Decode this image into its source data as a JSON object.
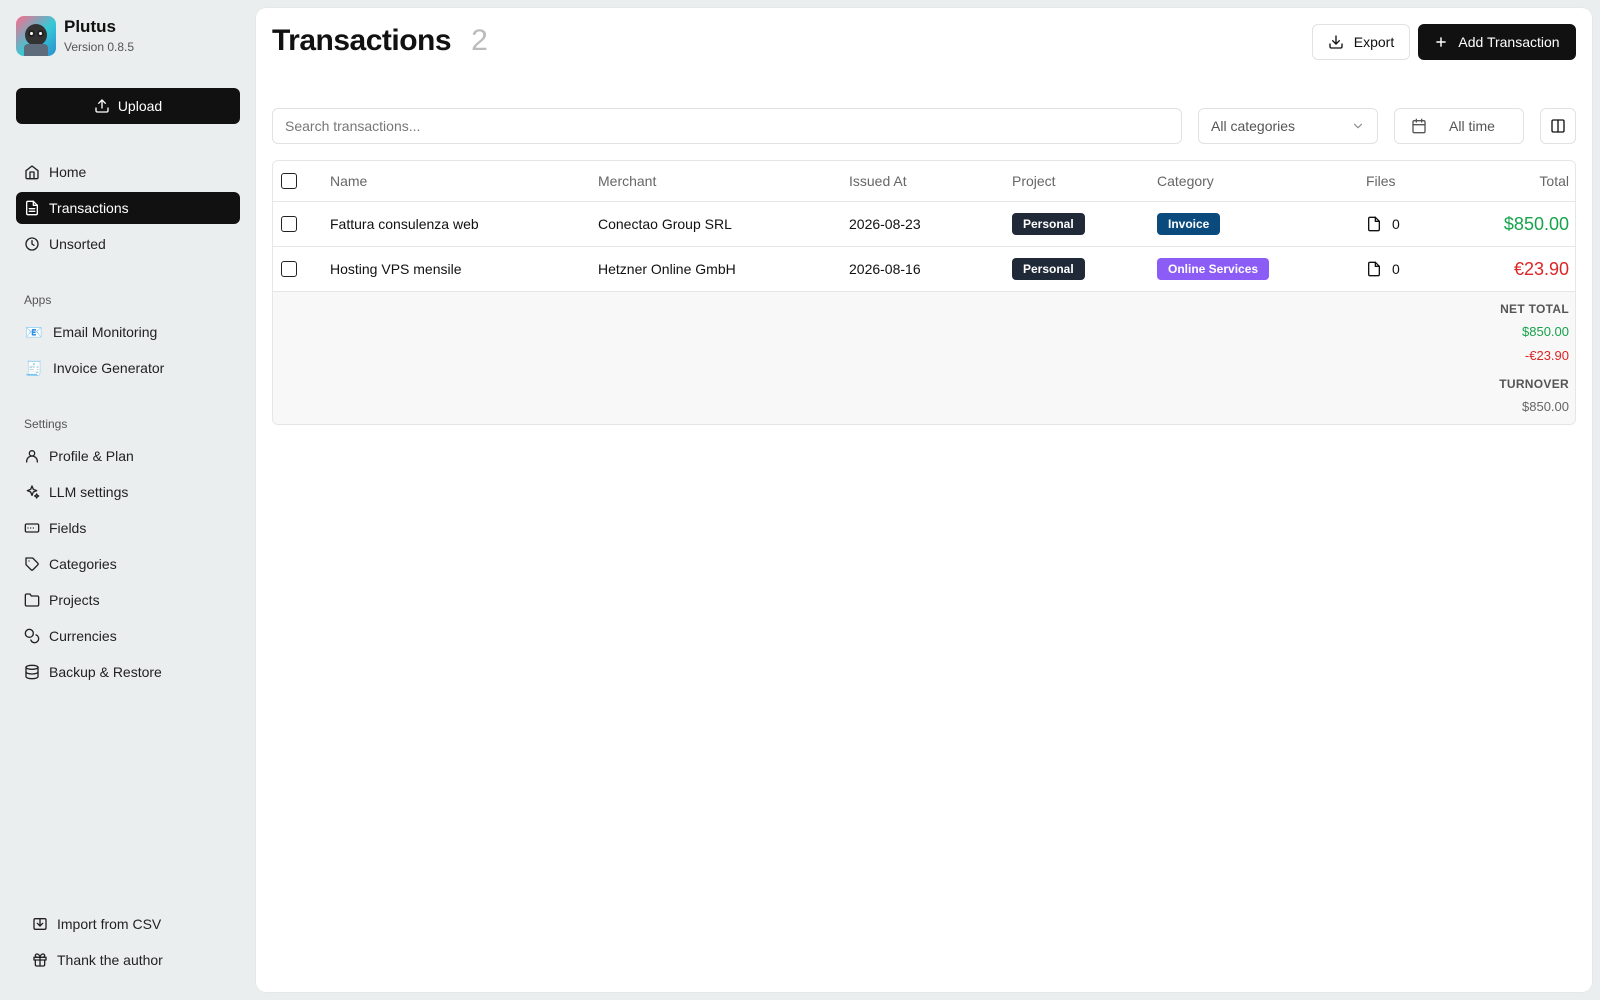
{
  "app": {
    "name": "Plutus",
    "version": "Version 0.8.5"
  },
  "sidebar": {
    "upload_label": "Upload",
    "nav": [
      {
        "label": "Home",
        "icon": "home-icon"
      },
      {
        "label": "Transactions",
        "icon": "file-text-icon",
        "active": true
      },
      {
        "label": "Unsorted",
        "icon": "clock-icon"
      }
    ],
    "apps_label": "Apps",
    "apps": [
      {
        "label": "Email Monitoring",
        "emoji": "📧"
      },
      {
        "label": "Invoice Generator",
        "emoji": "🧾"
      }
    ],
    "settings_label": "Settings",
    "settings": [
      {
        "label": "Profile & Plan",
        "icon": "user-icon"
      },
      {
        "label": "LLM settings",
        "icon": "sparkles-icon"
      },
      {
        "label": "Fields",
        "icon": "form-input-icon"
      },
      {
        "label": "Categories",
        "icon": "tag-icon"
      },
      {
        "label": "Projects",
        "icon": "folder-icon"
      },
      {
        "label": "Currencies",
        "icon": "coins-icon"
      },
      {
        "label": "Backup & Restore",
        "icon": "database-icon"
      }
    ],
    "bottom": [
      {
        "label": "Import from CSV",
        "icon": "import-icon"
      },
      {
        "label": "Thank the author",
        "icon": "gift-icon"
      }
    ]
  },
  "header": {
    "title": "Transactions",
    "count": "2",
    "export_label": "Export",
    "add_label": "Add Transaction"
  },
  "filters": {
    "search_placeholder": "Search transactions...",
    "category_select": "All categories",
    "date_range": "All time"
  },
  "table": {
    "columns": [
      "Name",
      "Merchant",
      "Issued At",
      "Project",
      "Category",
      "Files",
      "Total"
    ],
    "rows": [
      {
        "name": "Fattura consulenza web",
        "merchant": "Conectao Group SRL",
        "issued_at": "2026-08-23",
        "project": "Personal",
        "category": "Invoice",
        "category_color": "#0b4a7d",
        "files": "0",
        "total": "$850.00",
        "total_color": "#16a34a"
      },
      {
        "name": "Hosting VPS mensile",
        "merchant": "Hetzner Online GmbH",
        "issued_at": "2026-08-16",
        "project": "Personal",
        "category": "Online Services",
        "category_color": "#8b5cf6",
        "files": "0",
        "total": "€23.90",
        "total_color": "#dc2626"
      }
    ],
    "summary": {
      "net_total_label": "NET TOTAL",
      "net_positive": "$850.00",
      "net_negative": "-€23.90",
      "turnover_label": "TURNOVER",
      "turnover": "$850.00"
    }
  },
  "colors": {
    "project_badge": "#1f2937",
    "positive": "#16a34a",
    "negative": "#dc2626"
  }
}
